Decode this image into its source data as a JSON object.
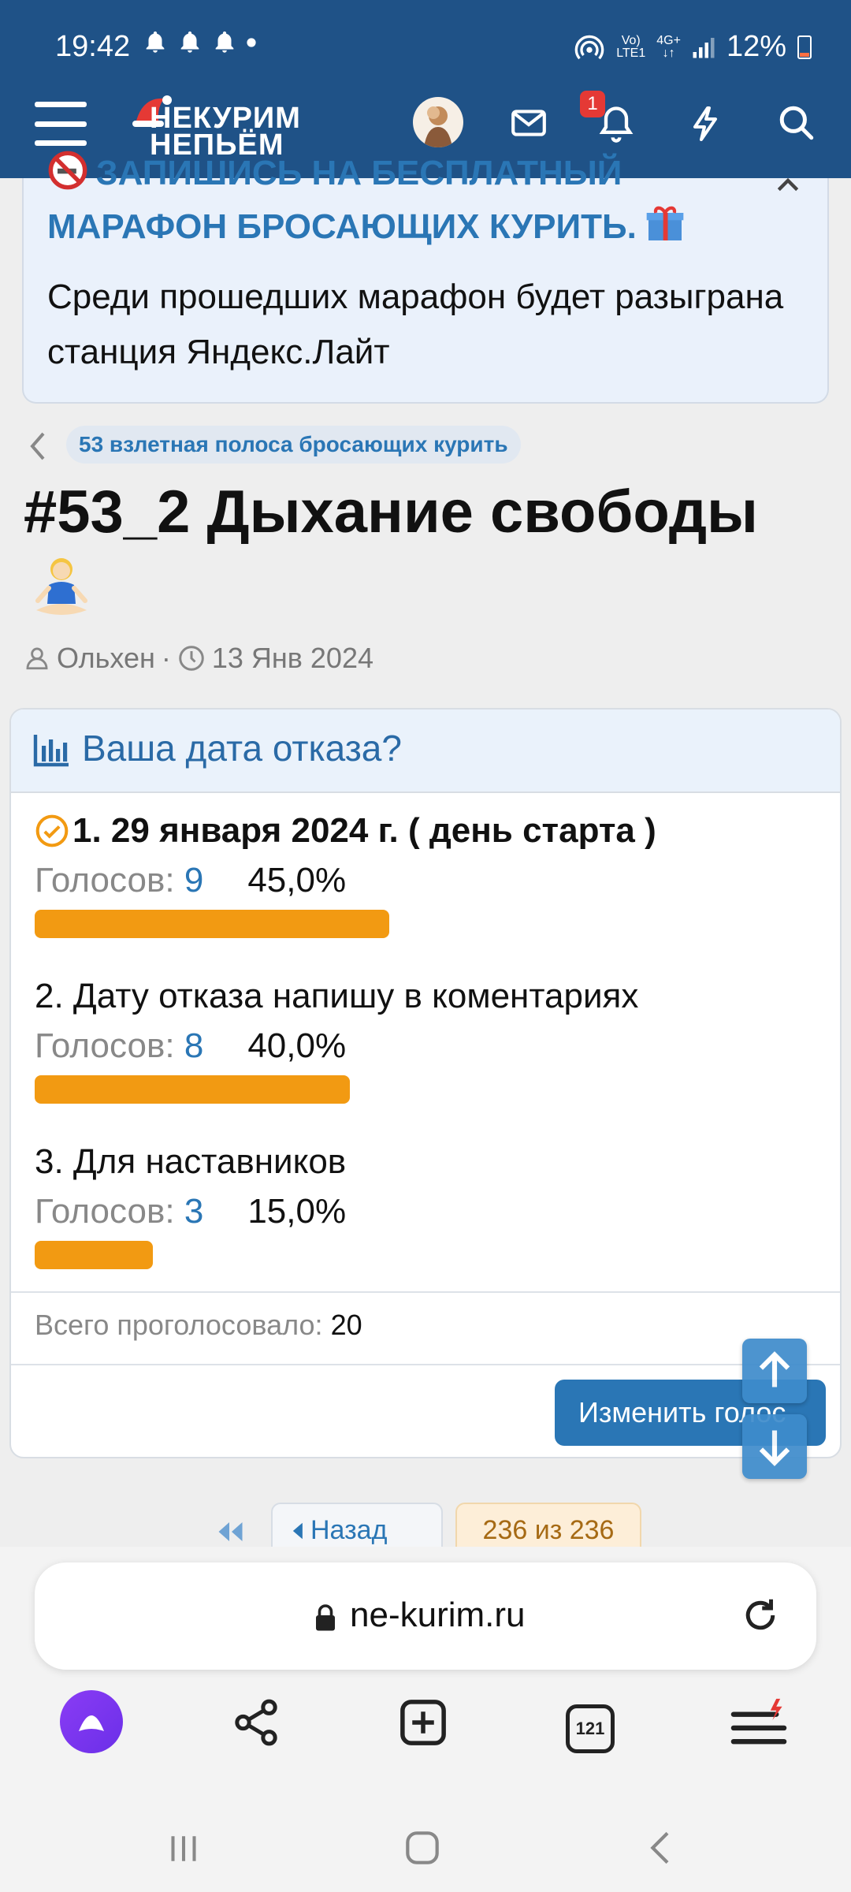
{
  "status": {
    "time": "19:42",
    "signal_label_top": "Vo)",
    "signal_label_bottom": "LTE1",
    "net_label": "4G+",
    "battery": "12%"
  },
  "header": {
    "logo_line1": "НЕКУРИМ",
    "logo_line2": "НЕПЬЁМ",
    "notifications_badge": "1"
  },
  "notice": {
    "title": "ЗАПИШИСЬ НА БЕСПЛАТНЫЙ МАРАФОН БРОСАЮЩИХ КУРИТЬ.",
    "text": "Среди прошедших марафон будет разыграна станция Яндекс.Лайт"
  },
  "breadcrumb": {
    "label": "53 взлетная полоса бросающих курить"
  },
  "thread": {
    "title": "#53_2 Дыхание свободы",
    "author": "Ольхен",
    "date": "13 Янв 2024"
  },
  "poll": {
    "question": "Ваша дата отказа?",
    "votes_label": "Голосов:",
    "options": [
      {
        "label": "1. 29 января 2024 г. ( день старта )",
        "votes": "9",
        "percent": "45,0%",
        "share": 0.45
      },
      {
        "label": "2. Дату отказа напишу в коментариях",
        "votes": "8",
        "percent": "40,0%",
        "share": 0.4
      },
      {
        "label": "3. Для наставников",
        "votes": "3",
        "percent": "15,0%",
        "share": 0.15
      }
    ],
    "total_label": "Всего проголосовало:",
    "total": "20",
    "change_button": "Изменить голос"
  },
  "pagination": {
    "back": "Назад",
    "count": "236 из 236"
  },
  "browser": {
    "url": "ne-kurim.ru",
    "tabs_count": "121"
  },
  "colors": {
    "header": "#1f5287",
    "accent": "#2a76b5",
    "bar": "#f29a12"
  }
}
